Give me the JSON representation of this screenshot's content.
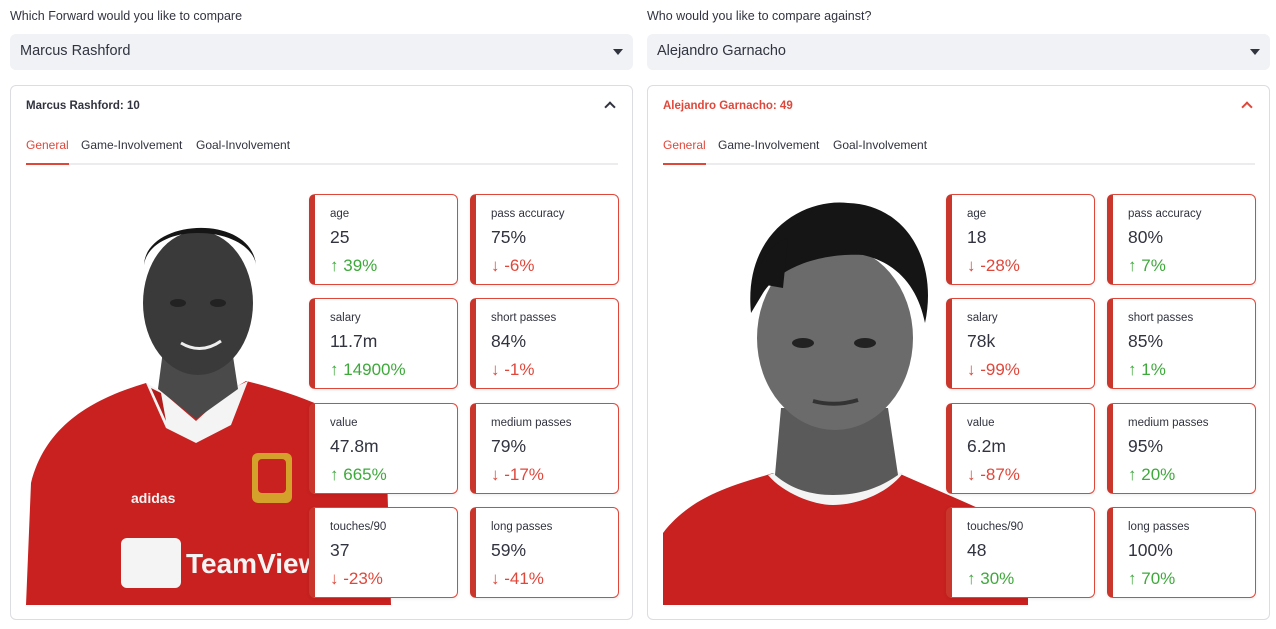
{
  "left": {
    "select_label": "Which Forward would you like to compare",
    "selected": "Marcus Rashford",
    "expander_title": "Marcus Rashford: 10",
    "tabs": [
      "General",
      "Game-Involvement",
      "Goal-Involvement"
    ],
    "photo_alt": "Marcus Rashford photo",
    "metrics": [
      {
        "label": "age",
        "value": "25",
        "delta": "39%",
        "direction": "up"
      },
      {
        "label": "pass accuracy",
        "value": "75%",
        "delta": "-6%",
        "direction": "down"
      },
      {
        "label": "salary",
        "value": "11.7m",
        "delta": "14900%",
        "direction": "up"
      },
      {
        "label": "short passes",
        "value": "84%",
        "delta": "-1%",
        "direction": "down"
      },
      {
        "label": "value",
        "value": "47.8m",
        "delta": "665%",
        "direction": "up"
      },
      {
        "label": "medium passes",
        "value": "79%",
        "delta": "-17%",
        "direction": "down"
      },
      {
        "label": "touches/90",
        "value": "37",
        "delta": "-23%",
        "direction": "down"
      },
      {
        "label": "long passes",
        "value": "59%",
        "delta": "-41%",
        "direction": "down"
      }
    ]
  },
  "right": {
    "select_label": "Who would you like to compare against?",
    "selected": "Alejandro Garnacho",
    "expander_title": "Alejandro Garnacho: 49",
    "tabs": [
      "General",
      "Game-Involvement",
      "Goal-Involvement"
    ],
    "photo_alt": "Alejandro Garnacho photo",
    "metrics": [
      {
        "label": "age",
        "value": "18",
        "delta": "-28%",
        "direction": "down"
      },
      {
        "label": "pass accuracy",
        "value": "80%",
        "delta": "7%",
        "direction": "up"
      },
      {
        "label": "salary",
        "value": "78k",
        "delta": "-99%",
        "direction": "down"
      },
      {
        "label": "short passes",
        "value": "85%",
        "delta": "1%",
        "direction": "up"
      },
      {
        "label": "value",
        "value": "6.2m",
        "delta": "-87%",
        "direction": "down"
      },
      {
        "label": "medium passes",
        "value": "95%",
        "delta": "20%",
        "direction": "up"
      },
      {
        "label": "touches/90",
        "value": "48",
        "delta": "30%",
        "direction": "up"
      },
      {
        "label": "long passes",
        "value": "100%",
        "delta": "70%",
        "direction": "up"
      }
    ]
  },
  "colors": {
    "accent": "#e0473b",
    "positive": "#3ea93b",
    "negative": "#e0473b",
    "select_bg": "#f0f2f6",
    "kit_red": "#c8211f"
  },
  "icons": {
    "select_caret": "caret-down-icon",
    "expander_toggle": "chevron-up-icon",
    "delta_up": "arrow-up-icon",
    "delta_down": "arrow-down-icon"
  },
  "logos": {
    "kit_text": "TeamViewer",
    "kit_brand": "adidas"
  }
}
